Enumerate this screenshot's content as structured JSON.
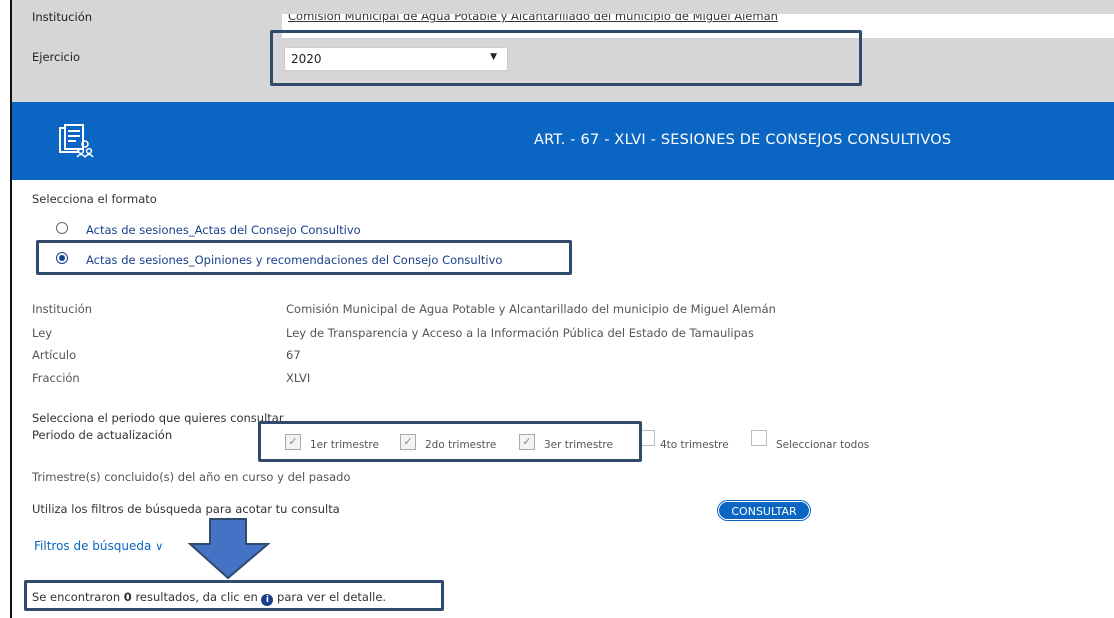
{
  "header": {
    "institution_label": "Institución",
    "institution_value": "Comisión Municipal de Agua Potable y Alcantarillado del municipio de Miguel Alemán",
    "year_label": "Ejercicio",
    "year_value": "2020"
  },
  "banner": {
    "title": "ART. - 67 - XLVI - SESIONES DE CONSEJOS CONSULTIVOS",
    "icon": "document-list-people-icon",
    "color": "#0b66c3"
  },
  "format": {
    "heading": "Selecciona el formato",
    "options": [
      {
        "label": "Actas de sesiones_Actas del Consejo Consultivo",
        "selected": false
      },
      {
        "label": "Actas de sesiones_Opiniones y recomendaciones del Consejo Consultivo",
        "selected": true
      }
    ]
  },
  "details": {
    "rows": [
      {
        "label": "Institución",
        "value": "Comisión Municipal de Agua Potable y Alcantarillado del municipio de Miguel Alemán"
      },
      {
        "label": "Ley",
        "value": "Ley de Transparencia y Acceso a la Información Pública del Estado de Tamaulipas"
      },
      {
        "label": "Artículo",
        "value": "67"
      },
      {
        "label": "Fracción",
        "value": "XLVI"
      }
    ]
  },
  "period": {
    "heading": "Selecciona el periodo que quieres consultar",
    "update_label": "Periodo de actualización",
    "options": [
      {
        "label": "1er trimestre",
        "checked": true
      },
      {
        "label": "2do trimestre",
        "checked": true
      },
      {
        "label": "3er trimestre",
        "checked": true
      },
      {
        "label": "4to trimestre",
        "checked": false
      },
      {
        "label": "Seleccionar todos",
        "checked": false
      }
    ],
    "note": "Trimestre(s) concluido(s) del año en curso y del pasado"
  },
  "search": {
    "hint": "Utiliza los filtros de búsqueda para acotar tu consulta",
    "button": "CONSULTAR",
    "filters_link": "Filtros de búsqueda",
    "result_prefix": "Se encontraron ",
    "result_count": "0",
    "result_mid": " resultados, da clic en ",
    "result_suffix": " para ver el detalle."
  },
  "colors": {
    "accent": "#0b66c3",
    "highlight": "#2f4a6d",
    "arrow": "#4472c4"
  }
}
